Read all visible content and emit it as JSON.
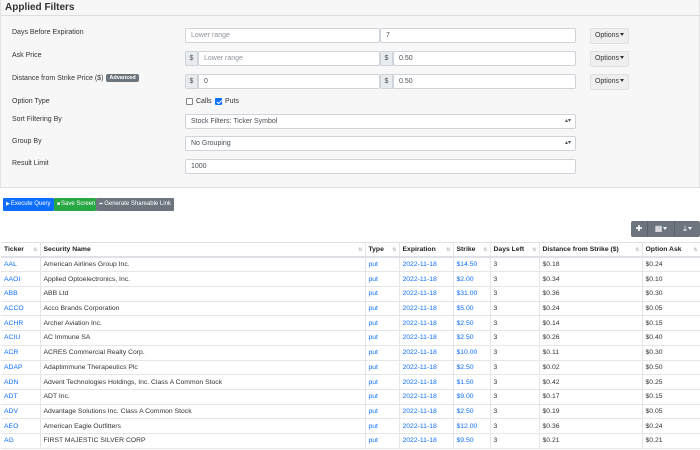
{
  "title": "Applied Filters",
  "filters": {
    "days_before_expiration": {
      "label": "Days Before Expiration",
      "lower_placeholder": "Lower range",
      "upper_value": "7",
      "options_label": "Options"
    },
    "ask_price": {
      "label": "Ask Price",
      "currency": "$",
      "lower_placeholder": "Lower range",
      "upper_value": "0.50",
      "options_label": "Options"
    },
    "distance_from_strike": {
      "label": "Distance from Strike Price ($)",
      "badge": "Advanced",
      "currency": "$",
      "lower_value": "0",
      "upper_value": "0.50",
      "options_label": "Options"
    },
    "option_type": {
      "label": "Option Type",
      "calls_label": "Calls",
      "calls_checked": false,
      "puts_label": "Puts",
      "puts_checked": true
    },
    "sort_filtering_by": {
      "label": "Sort Filtering By",
      "value": "Stock Filters: Ticker Symbol"
    },
    "group_by": {
      "label": "Group By",
      "value": "No Grouping"
    },
    "result_limit": {
      "label": "Result Limit",
      "value": "1000"
    }
  },
  "actions": {
    "execute": "Execute Query",
    "save": "Save Screen",
    "share": "Generate Shareable Link"
  },
  "table": {
    "columns": [
      "Ticker",
      "Security Name",
      "Type",
      "Expiration",
      "Strike",
      "Days Left",
      "Distance from Strike ($)",
      "Option Ask"
    ],
    "rows": [
      [
        "AAL",
        "American Airlines Group Inc.",
        "put",
        "2022-11-18",
        "$14.50",
        "3",
        "$0.18",
        "$0.24"
      ],
      [
        "AAOI",
        "Applied Optoelectronics, Inc.",
        "put",
        "2022-11-18",
        "$2.00",
        "3",
        "$0.34",
        "$0.10"
      ],
      [
        "ABB",
        "ABB Ltd",
        "put",
        "2022-11-18",
        "$31.00",
        "3",
        "$0.36",
        "$0.30"
      ],
      [
        "ACCO",
        "Acco Brands Corporation",
        "put",
        "2022-11-18",
        "$5.00",
        "3",
        "$0.24",
        "$0.05"
      ],
      [
        "ACHR",
        "Archer Aviation Inc.",
        "put",
        "2022-11-18",
        "$2.50",
        "3",
        "$0.14",
        "$0.15"
      ],
      [
        "ACIU",
        "AC Immune SA",
        "put",
        "2022-11-18",
        "$2.50",
        "3",
        "$0.26",
        "$0.40"
      ],
      [
        "ACR",
        "ACRES Commercial Realty Corp.",
        "put",
        "2022-11-18",
        "$10.00",
        "3",
        "$0.11",
        "$0.30"
      ],
      [
        "ADAP",
        "Adaptimmune Therapeutics Plc",
        "put",
        "2022-11-18",
        "$2.50",
        "3",
        "$0.02",
        "$0.50"
      ],
      [
        "ADN",
        "Advent Technologies Holdings, Inc. Class A Common Stock",
        "put",
        "2022-11-18",
        "$1.50",
        "3",
        "$0.42",
        "$0.25"
      ],
      [
        "ADT",
        "ADT Inc.",
        "put",
        "2022-11-18",
        "$9.00",
        "3",
        "$0.17",
        "$0.15"
      ],
      [
        "ADV",
        "Advantage Solutions Inc. Class A Common Stock",
        "put",
        "2022-11-18",
        "$2.50",
        "3",
        "$0.19",
        "$0.05"
      ],
      [
        "AEO",
        "American Eagle Outfitters",
        "put",
        "2022-11-18",
        "$12.00",
        "3",
        "$0.36",
        "$0.24"
      ],
      [
        "AG",
        "FIRST MAJESTIC SILVER CORP",
        "put",
        "2022-11-18",
        "$9.50",
        "3",
        "$0.21",
        "$0.21"
      ]
    ]
  },
  "colors": {
    "accent": "#0d6efd",
    "success": "#28a745",
    "secondary": "#6c757d"
  }
}
